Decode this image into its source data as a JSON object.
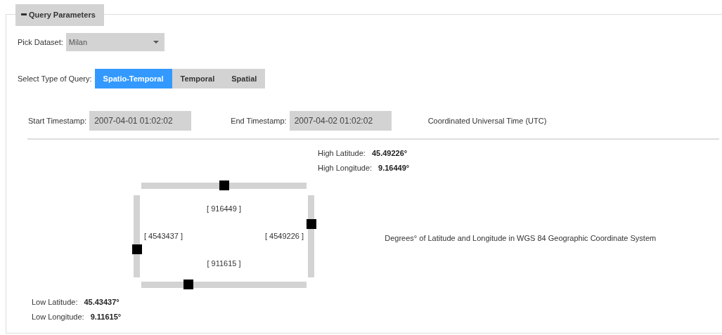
{
  "panel": {
    "title": "Query Parameters",
    "expanded": true
  },
  "dataset": {
    "label": "Pick Dataset:",
    "value": "Milan"
  },
  "query_type": {
    "label": "Select Type of Query:",
    "options": [
      {
        "label": "Spatio-Temporal",
        "selected": true
      },
      {
        "label": "Temporal",
        "selected": false
      },
      {
        "label": "Spatial",
        "selected": false
      }
    ]
  },
  "timestamps": {
    "start": {
      "label": "Start Timestamp:",
      "value": "2007-04-01 01:02:02"
    },
    "end": {
      "label": "End Timestamp:",
      "value": "2007-04-02 01:02:02"
    },
    "note": "Coordinated Universal Time (UTC)"
  },
  "high": [
    {
      "label": "High Latitude:",
      "value": "45.49226°"
    },
    {
      "label": "High Longitude:",
      "value": "9.16449°"
    }
  ],
  "sliders": [
    {
      "kind": "top",
      "level": 0.5,
      "reading": "[ 916449 ]"
    },
    {
      "kind": "left",
      "level": 0.34,
      "reading": "[ 4543437 ]"
    },
    {
      "kind": "right",
      "level": 0.65,
      "reading": "[ 4549226 ]"
    },
    {
      "kind": "bottom",
      "level": 0.285,
      "reading": "[ 911615 ]"
    }
  ],
  "coordinate_note": "Degrees° of Latitude and Longitude in WGS 84 Geographic Coordinate System",
  "low": [
    {
      "label": "Low Latitude:",
      "value": "45.43437°"
    },
    {
      "label": "Low Longitude:",
      "value": "9.11615°"
    }
  ]
}
